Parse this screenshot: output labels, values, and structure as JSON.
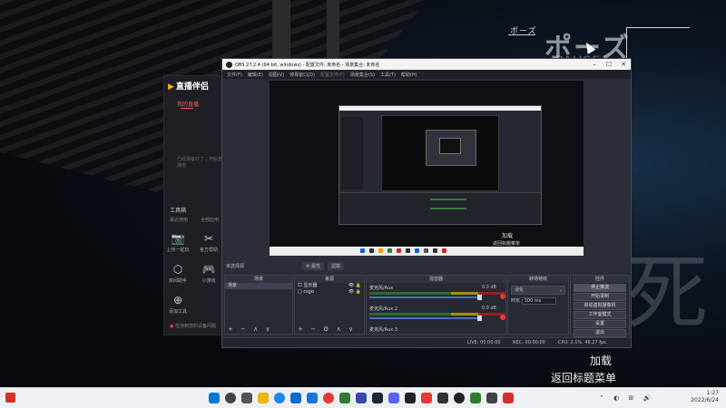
{
  "game": {
    "pause_small": "ポーズ",
    "pause_big": "ポーズ",
    "pause_en": "PAUSE",
    "big_glyph": "死",
    "menu": {
      "load": "加载",
      "return_title": "返回标题菜单"
    }
  },
  "helper": {
    "logo": "直播伴侣",
    "tab": "我的直播",
    "notice": "已经准备好了 | 开始直播吧",
    "section": "工具箱",
    "sub_left": "最近使用",
    "sub_right": "全部应用",
    "tools": [
      {
        "label": "上传一起玩",
        "icon": "📷"
      },
      {
        "label": "官方帮助",
        "icon": "✂"
      },
      {
        "label": "房间助手",
        "icon": "⬡"
      },
      {
        "label": "小游戏",
        "icon": "🎮"
      }
    ],
    "more_label": "添加工具",
    "footer_prefix": "●",
    "footer": "检测到您的设备问题"
  },
  "obs": {
    "title": "OBS 27.2.4 (64-bit, windows) - 配置文件: 未命名 - 场景集合: 未命名",
    "menu": [
      "文件(F)",
      "编辑(E)",
      "视图(V)",
      "停靠窗口(D)",
      "配置文件(P)",
      "场景集合(S)",
      "工具(T)",
      "帮助(H)"
    ],
    "preview_labels": {
      "load": "加载",
      "return_title": "返回标题菜单"
    },
    "source_status": "未选择源",
    "properties_btn": "⚙ 属性",
    "filters_btn": "滤镜",
    "scenes": {
      "header": "场景",
      "items": [
        "场景"
      ]
    },
    "sources": {
      "header": "来源",
      "items": [
        "显示器",
        "csgo"
      ]
    },
    "mixer": {
      "header": "混音器",
      "channels": [
        {
          "name": "麦克风/Aux",
          "db": "0.0 dB"
        },
        {
          "name": "麦克风/Aux 2",
          "db": "0.0 dB"
        },
        {
          "name": "麦克风/Aux 3",
          "db": ""
        }
      ]
    },
    "transitions": {
      "header": "转场特效",
      "type": "淡化",
      "duration_label": "时长",
      "duration_value": "300 ms"
    },
    "controls": {
      "header": "控件",
      "buttons": [
        "停止推流",
        "开始录制",
        "启动虚拟摄像机",
        "工作室模式",
        "设置",
        "退出"
      ]
    },
    "status": {
      "live": "LIVE: 00:00:00",
      "rec": "REC: 00:00:00",
      "cpu": "CPU: 2.1%, 46.27 fps"
    },
    "dock_footer": "+ − ∧ ∨"
  },
  "taskbar": {
    "time": "1:27",
    "date": "2022/6/24"
  },
  "colors": {
    "obs_bg": "#2b2e38",
    "accent_red": "#e53935",
    "taskbar_bg": "#eef0f3"
  }
}
